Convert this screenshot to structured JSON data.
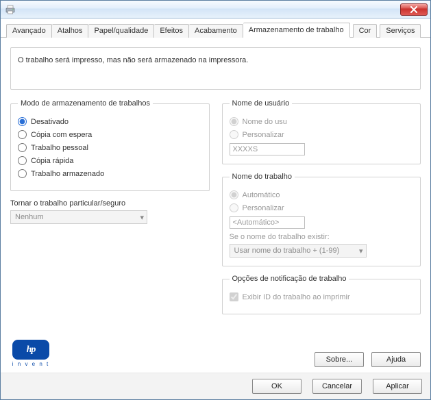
{
  "tabs": {
    "items": [
      {
        "label": "Avançado"
      },
      {
        "label": "Atalhos"
      },
      {
        "label": "Papel/qualidade"
      },
      {
        "label": "Efeitos"
      },
      {
        "label": "Acabamento"
      },
      {
        "label": "Armazenamento de trabalho"
      },
      {
        "label": "Cor"
      },
      {
        "label": "Serviços"
      }
    ],
    "active_index": 5
  },
  "description": "O trabalho será impresso, mas não será armazenado na impressora.",
  "storage_mode": {
    "legend": "Modo de armazenamento de trabalhos",
    "options": [
      {
        "label": "Desativado",
        "checked": true
      },
      {
        "label": "Cópia com espera",
        "checked": false
      },
      {
        "label": "Trabalho pessoal",
        "checked": false
      },
      {
        "label": "Cópia rápida",
        "checked": false
      },
      {
        "label": "Trabalho armazenado",
        "checked": false
      }
    ]
  },
  "secure": {
    "title": "Tornar o trabalho particular/seguro",
    "value": "Nenhum"
  },
  "username": {
    "legend": "Nome de usuário",
    "opt_auto": "Nome do usu",
    "opt_custom": "Personalizar",
    "input_value": "XXXXS"
  },
  "jobname": {
    "legend": "Nome do trabalho",
    "opt_auto": "Automático",
    "opt_custom": "Personalizar",
    "input_value": "<Automático>",
    "exists_label": "Se o nome do trabalho existir:",
    "exists_value": "Usar nome do trabalho + (1-99)"
  },
  "notify": {
    "legend": "Opções de notificação de trabalho",
    "show_id_label": "Exibir ID do trabalho ao imprimir"
  },
  "logo": {
    "hp": "hp",
    "invent": "i n v e n t"
  },
  "page_buttons": {
    "about": "Sobre...",
    "help": "Ajuda"
  },
  "dialog_buttons": {
    "ok": "OK",
    "cancel": "Cancelar",
    "apply": "Aplicar"
  }
}
